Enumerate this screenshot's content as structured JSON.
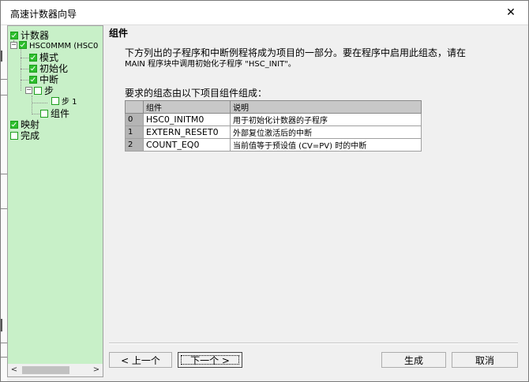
{
  "window": {
    "title": "高速计数器向导",
    "close_glyph": "✕"
  },
  "tree": {
    "items": [
      {
        "label": "计数器",
        "checked": true
      },
      {
        "label": "HSC0MMM (HSC0",
        "checked": true
      },
      {
        "label": "模式",
        "checked": true
      },
      {
        "label": "初始化",
        "checked": true
      },
      {
        "label": "中断",
        "checked": true
      },
      {
        "label": "步",
        "checked": false
      },
      {
        "label": "步 1",
        "checked": false
      },
      {
        "label": "组件",
        "checked": false
      },
      {
        "label": "映射",
        "checked": true
      },
      {
        "label": "完成",
        "checked": false
      }
    ],
    "expander_minus": "−",
    "scroll_left": "<",
    "scroll_right": ">"
  },
  "content": {
    "heading": "组件",
    "desc_line1": "下方列出的子程序和中断例程将成为项目的一部分。要在程序中启用此组态，请在",
    "desc_line2": "MAIN 程序块中调用初始化子程序 \"HSC_INIT\"。",
    "required": "要求的组态由以下项目组件组成：",
    "table": {
      "headers": [
        "",
        "组件",
        "说明"
      ],
      "rows": [
        {
          "index": "0",
          "name": "HSC0_INITM0",
          "desc": "用于初始化计数器的子程序"
        },
        {
          "index": "1",
          "name": "EXTERN_RESET0",
          "desc": "外部复位激活后的中断"
        },
        {
          "index": "2",
          "name": "COUNT_EQ0",
          "desc": "当前值等于预设值 (CV=PV) 时的中断"
        }
      ]
    }
  },
  "buttons": {
    "prev": "< 上一个",
    "next": "下一个 >",
    "generate": "生成",
    "cancel": "取消"
  },
  "colors": {
    "tree_bg": "#c8f0c8",
    "check_green": "#2dbf2d"
  }
}
